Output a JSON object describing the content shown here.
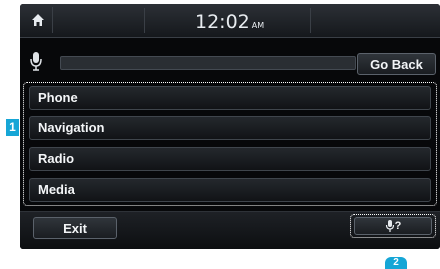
{
  "topbar": {
    "time": "12:02",
    "ampm": "AM"
  },
  "search": {
    "go_back_label": "Go Back",
    "value": ""
  },
  "menu": {
    "items": [
      "Phone",
      "Navigation",
      "Radio",
      "Media"
    ]
  },
  "bottom": {
    "exit_label": "Exit",
    "help_label": "?"
  },
  "callouts": {
    "list": "1",
    "help": "2"
  },
  "icons": {
    "home": "home-icon",
    "mic": "microphone-icon",
    "help": "voice-help-icon"
  },
  "colors": {
    "screen_bg": "#07080a",
    "highlight": "#ffffff",
    "callout": "#16a6d6"
  }
}
